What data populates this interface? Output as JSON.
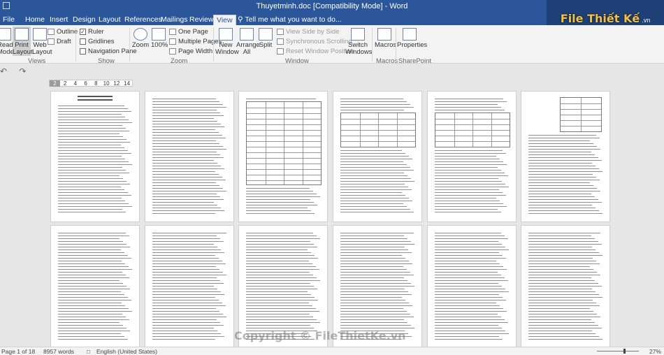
{
  "window": {
    "title": "Thuyetminh.doc [Compatibility Mode] - Word"
  },
  "tabs": [
    "File",
    "Home",
    "Insert",
    "Design",
    "Layout",
    "References",
    "Mailings",
    "Review",
    "View"
  ],
  "active_tab": "View",
  "tell_me": "Tell me what you want to do...",
  "logo": {
    "text": "File Thiết Kế",
    "domain": ".vn"
  },
  "ribbon": {
    "views": {
      "read_mode": "Read Mode",
      "print_layout": "Print Layout",
      "web_layout": "Web Layout",
      "outline": "Outline",
      "draft": "Draft",
      "group": "Views"
    },
    "show": {
      "ruler": "Ruler",
      "gridlines": "Gridlines",
      "navigation_pane": "Navigation Pane",
      "group": "Show",
      "ruler_checked": true,
      "gridlines_checked": false,
      "navigation_checked": false
    },
    "zoom": {
      "zoom": "Zoom",
      "hundred": "100%",
      "one_page": "One Page",
      "multiple_pages": "Multiple Pages",
      "page_width": "Page Width",
      "group": "Zoom"
    },
    "window": {
      "new_window": "New Window",
      "arrange_all": "Arrange All",
      "split": "Split",
      "view_side_by_side": "View Side by Side",
      "synchronous_scrolling": "Synchronous Scrolling",
      "reset_window_position": "Reset Window Position",
      "switch_windows": "Switch Windows",
      "group": "Window"
    },
    "macros": {
      "label": "Macros",
      "group": "Macros"
    },
    "sharepoint": {
      "label": "Properties",
      "group": "SharePoint"
    }
  },
  "ruler_ticks": [
    "2",
    "2",
    "4",
    "6",
    "8",
    "10",
    "12",
    "14"
  ],
  "status": {
    "page": "Page 1 of 18",
    "words": "8957 words",
    "language": "English (United States)",
    "zoom": "27%"
  },
  "watermark": "Copyright © FileThietKe.vn"
}
